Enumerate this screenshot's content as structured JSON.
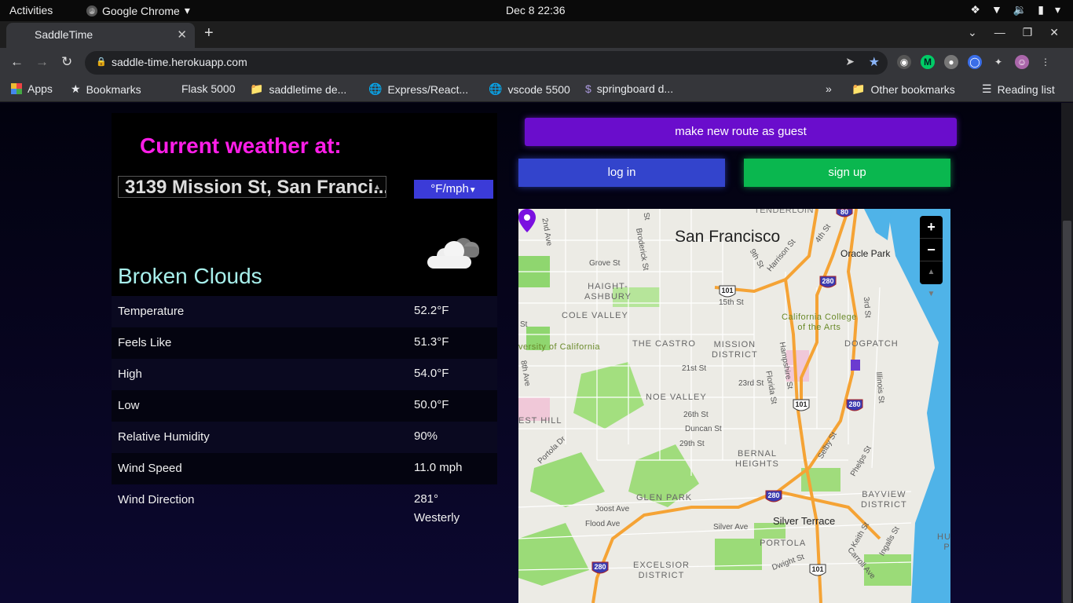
{
  "system": {
    "activities": "Activities",
    "app_name": "Google Chrome",
    "clock": "Dec 8  22:36"
  },
  "browser": {
    "tab_title": "SaddleTime",
    "url": "saddle-time.herokuapp.com",
    "bookmarks": [
      {
        "label": "Apps",
        "icon": "apps-grid-icon"
      },
      {
        "label": "Bookmarks",
        "icon": "star-icon"
      },
      {
        "label": "Flask 5000",
        "icon": "none"
      },
      {
        "label": "saddletime de...",
        "icon": "folder-icon"
      },
      {
        "label": "Express/React...",
        "icon": "globe-icon"
      },
      {
        "label": "vscode 5500",
        "icon": "globe-icon"
      },
      {
        "label": "springboard d...",
        "icon": "springboard-icon"
      }
    ],
    "overflow": "»",
    "other_bookmarks": "Other bookmarks",
    "reading_list": "Reading list"
  },
  "weather": {
    "title": "Current weather at:",
    "location": "3139 Mission St, San Franci...",
    "units": "°F/mph",
    "condition": "Broken Clouds",
    "condition_icon": "broken-clouds-icon",
    "rows": [
      {
        "label": "Temperature",
        "value": "52.2°F"
      },
      {
        "label": "Feels Like",
        "value": "51.3°F"
      },
      {
        "label": "High",
        "value": "54.0°F"
      },
      {
        "label": "Low",
        "value": "50.0°F"
      },
      {
        "label": "Relative Humidity",
        "value": "90%"
      },
      {
        "label": "Wind Speed",
        "value": "11.0 mph"
      },
      {
        "label": "Wind Direction",
        "value": "281°",
        "value2": "Westerly"
      }
    ]
  },
  "actions": {
    "guest": "make new route as guest",
    "login": "log in",
    "signup": "sign up"
  },
  "map": {
    "city": "San Francisco",
    "zoom_in": "+",
    "zoom_out": "−",
    "labels": {
      "tenderloin": "TENDERLOIN",
      "haight1": "HAIGHT-",
      "haight2": "ASHBURY",
      "cole_valley": "COLE VALLEY",
      "castro": "THE CASTRO",
      "mission1": "MISSION",
      "mission2": "DISTRICT",
      "noe": "NOE VALLEY",
      "bernal1": "BERNAL",
      "bernal2": "HEIGHTS",
      "glen_park": "GLEN PARK",
      "dogpatch": "DOGPATCH",
      "bayview1": "BAYVIEW",
      "bayview2": "DISTRICT",
      "portola": "PORTOLA",
      "excelsior1": "EXCELSIOR",
      "excelsior2": "DISTRICT",
      "west_hill": "EST HILL",
      "hunt1": "HUNT",
      "hunt2": "PO",
      "oracle": "Oracle Park",
      "cca1": "California College",
      "cca2": "of the Arts",
      "ucsf": "versity of California",
      "silver_terrace": "Silver Terrace",
      "grove": "Grove St",
      "broderick": "Broderick St",
      "ninth": "9th St",
      "harrison": "Harrison St",
      "fifteenth": "15th St",
      "twentyfirst": "21st St",
      "twentythird": "23rd St",
      "twentysixth": "26th St",
      "duncan": "Duncan St",
      "twentyninth": "29th St",
      "hampshire": "Hampshire St",
      "florida": "Florida St",
      "third": "3rd St",
      "illinois": "Illinois St",
      "portola_dr": "Portola Dr",
      "joost": "Joost Ave",
      "flood": "Flood Ave",
      "silver_ave": "Silver Ave",
      "dwight": "Dwight St",
      "selby": "Selby St",
      "phelps": "Phelps St",
      "keith": "Keith St",
      "ingalls": "Ingalls St",
      "carroll": "Carroll Ave",
      "second_ave": "2nd Ave",
      "eighth_ave": "8th Ave",
      "fourth": "4th St",
      "st1": "St",
      "st2": "St"
    },
    "shields": [
      "101",
      "280",
      "80"
    ]
  }
}
